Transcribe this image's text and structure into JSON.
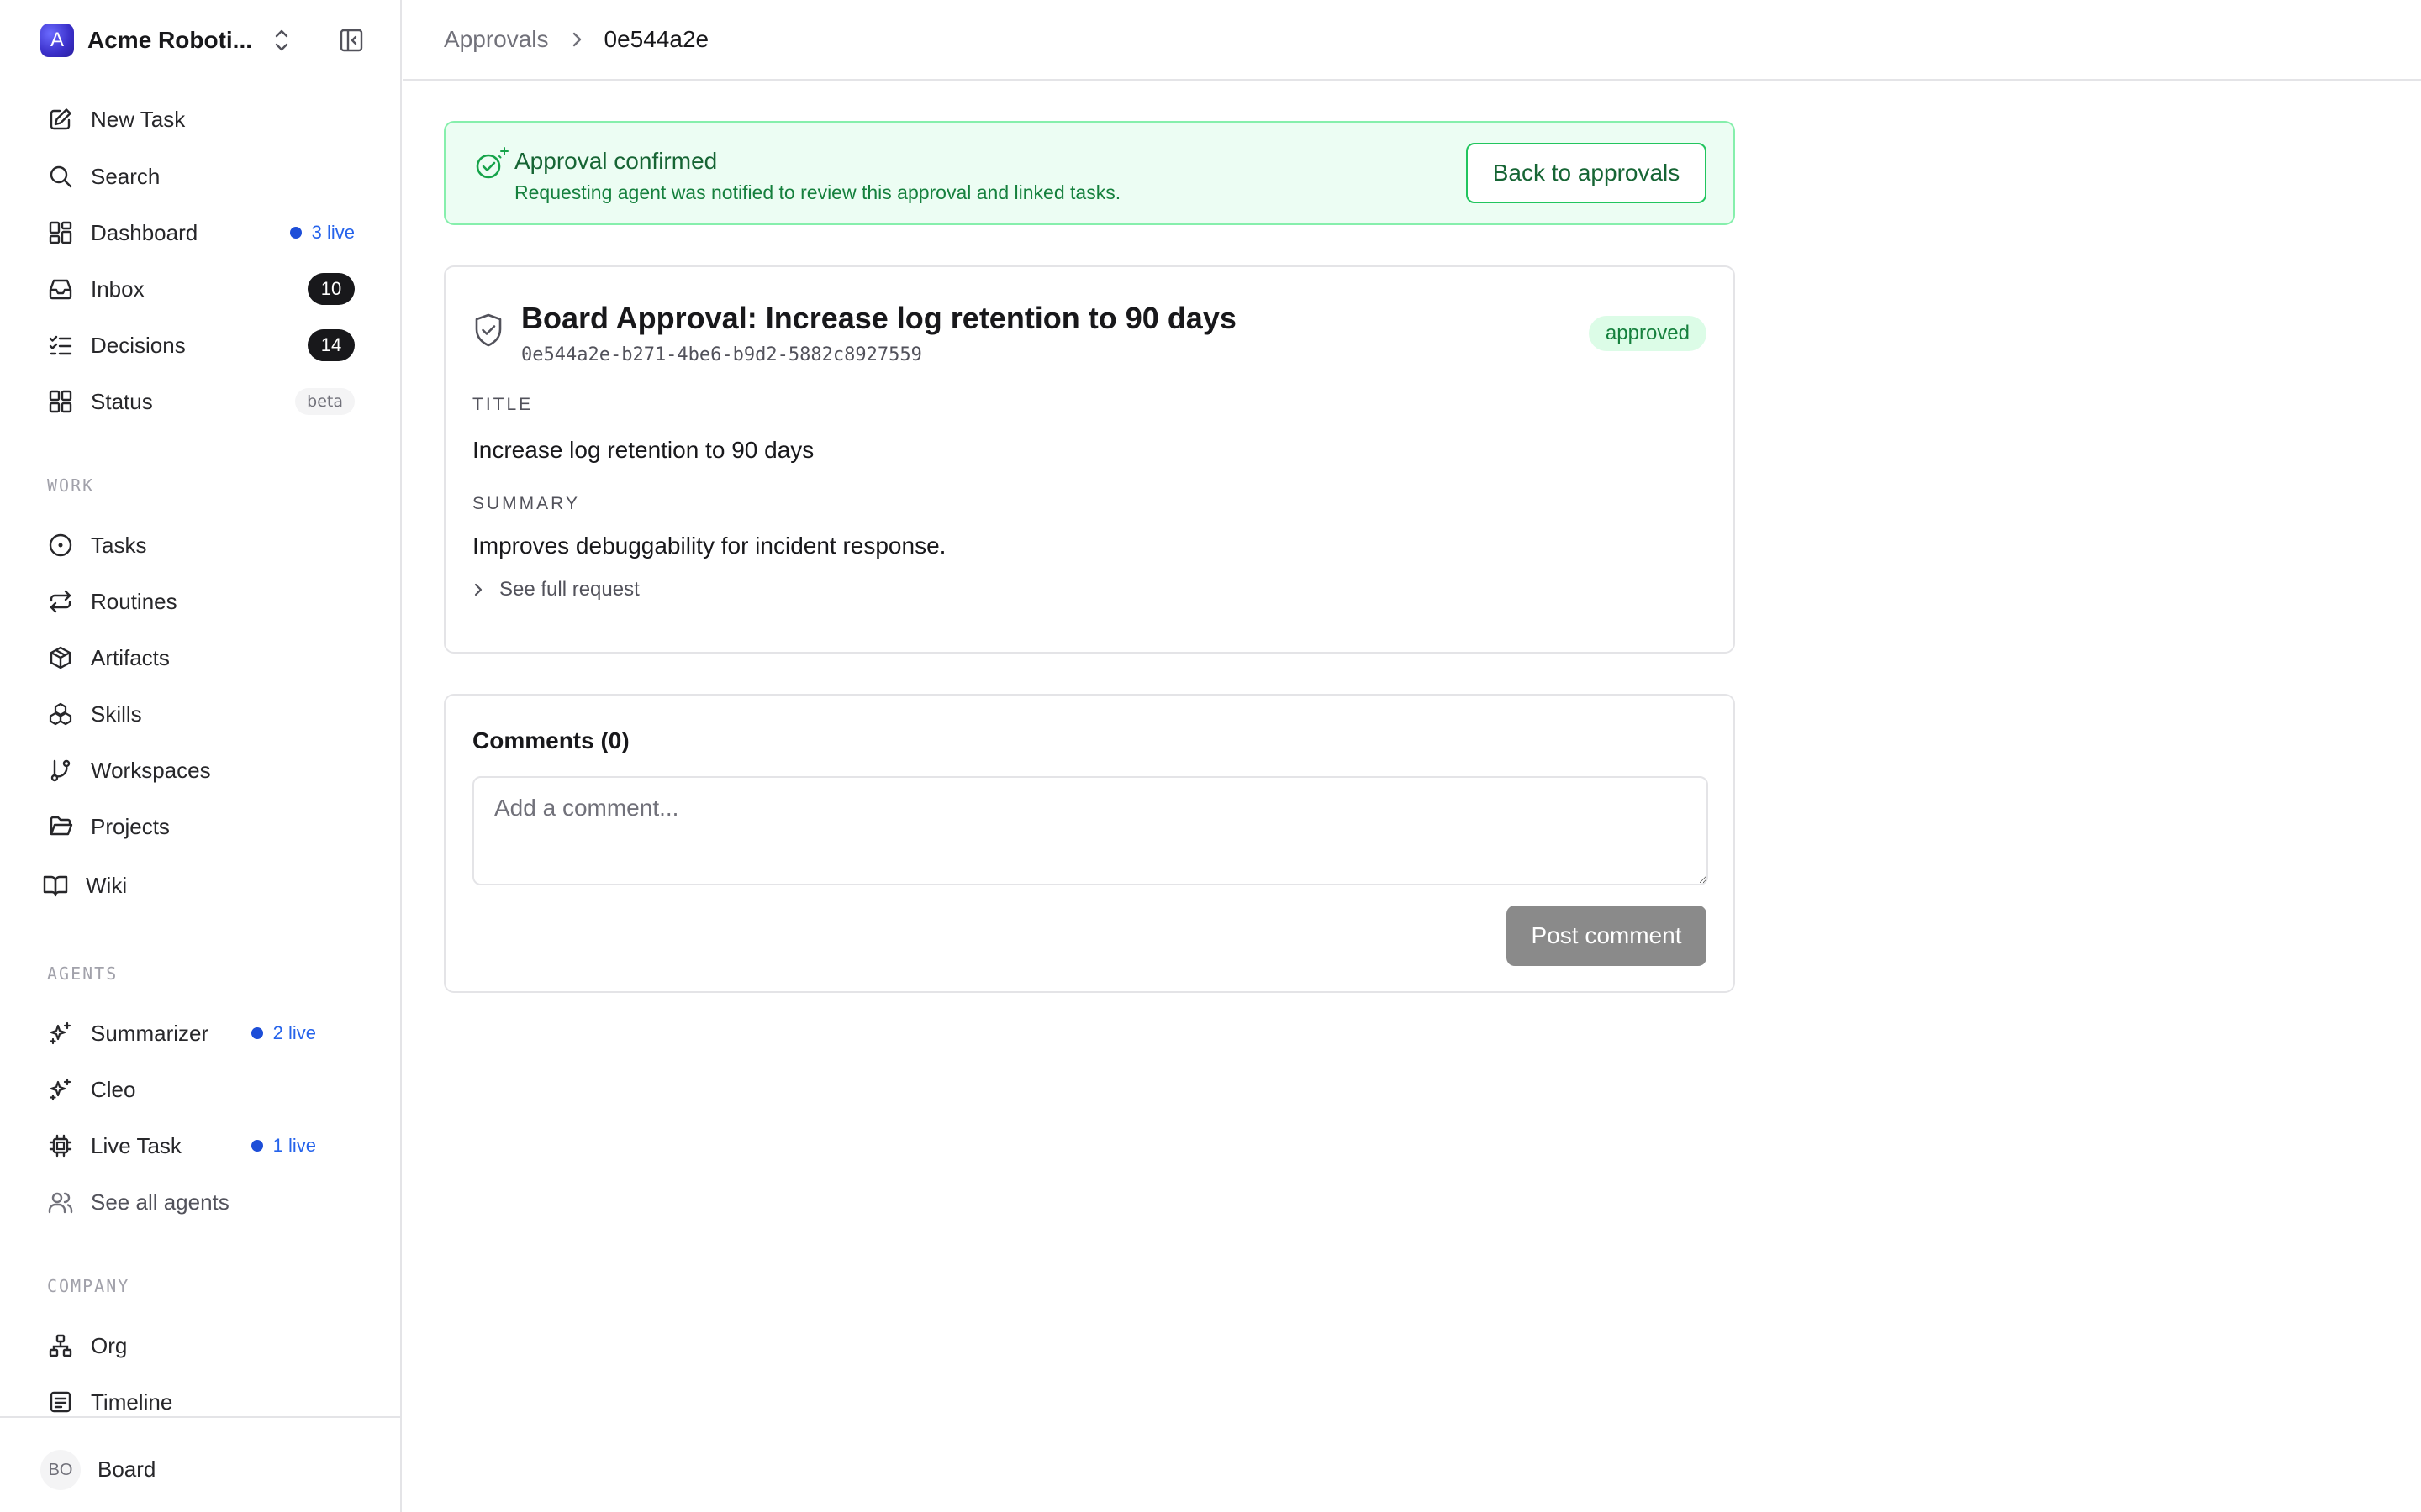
{
  "workspace": {
    "name": "Acme Roboti...",
    "initial": "A"
  },
  "nav": {
    "new_task": "New Task",
    "search": "Search",
    "dashboard": {
      "label": "Dashboard",
      "live": "3 live"
    },
    "inbox": {
      "label": "Inbox",
      "count": "10"
    },
    "decisions": {
      "label": "Decisions",
      "count": "14"
    },
    "status": {
      "label": "Status",
      "badge": "beta"
    }
  },
  "work": {
    "heading": "WORK",
    "items": [
      "Tasks",
      "Routines",
      "Artifacts",
      "Skills",
      "Workspaces",
      "Projects",
      "Wiki"
    ]
  },
  "agents": {
    "heading": "AGENTS",
    "items": [
      {
        "label": "Summarizer",
        "live": "2 live"
      },
      {
        "label": "Cleo"
      },
      {
        "label": "Live Task",
        "live": "1 live"
      }
    ],
    "see_all": "See all agents"
  },
  "company": {
    "heading": "COMPANY",
    "items": [
      "Org",
      "Timeline"
    ]
  },
  "user": {
    "initials": "BO",
    "name": "Board"
  },
  "breadcrumb": {
    "parent": "Approvals",
    "current": "0e544a2e"
  },
  "banner": {
    "title": "Approval confirmed",
    "subtitle": "Requesting agent was notified to review this approval and linked tasks.",
    "button": "Back to approvals"
  },
  "approval": {
    "title": "Board Approval: Increase log retention to 90 days",
    "id": "0e544a2e-b271-4be6-b9d2-5882c8927559",
    "status": "approved",
    "title_label": "TITLE",
    "title_value": "Increase log retention to 90 days",
    "summary_label": "SUMMARY",
    "summary_value": "Improves debuggability for incident response.",
    "see_full": "See full request"
  },
  "comments": {
    "title": "Comments (0)",
    "placeholder": "Add a comment...",
    "post_button": "Post comment"
  },
  "colors": {
    "accent_blue": "#1d4ed8",
    "success_green": "#166534",
    "banner_bg": "#ecfdf3",
    "badge_dark": "#18181b"
  }
}
